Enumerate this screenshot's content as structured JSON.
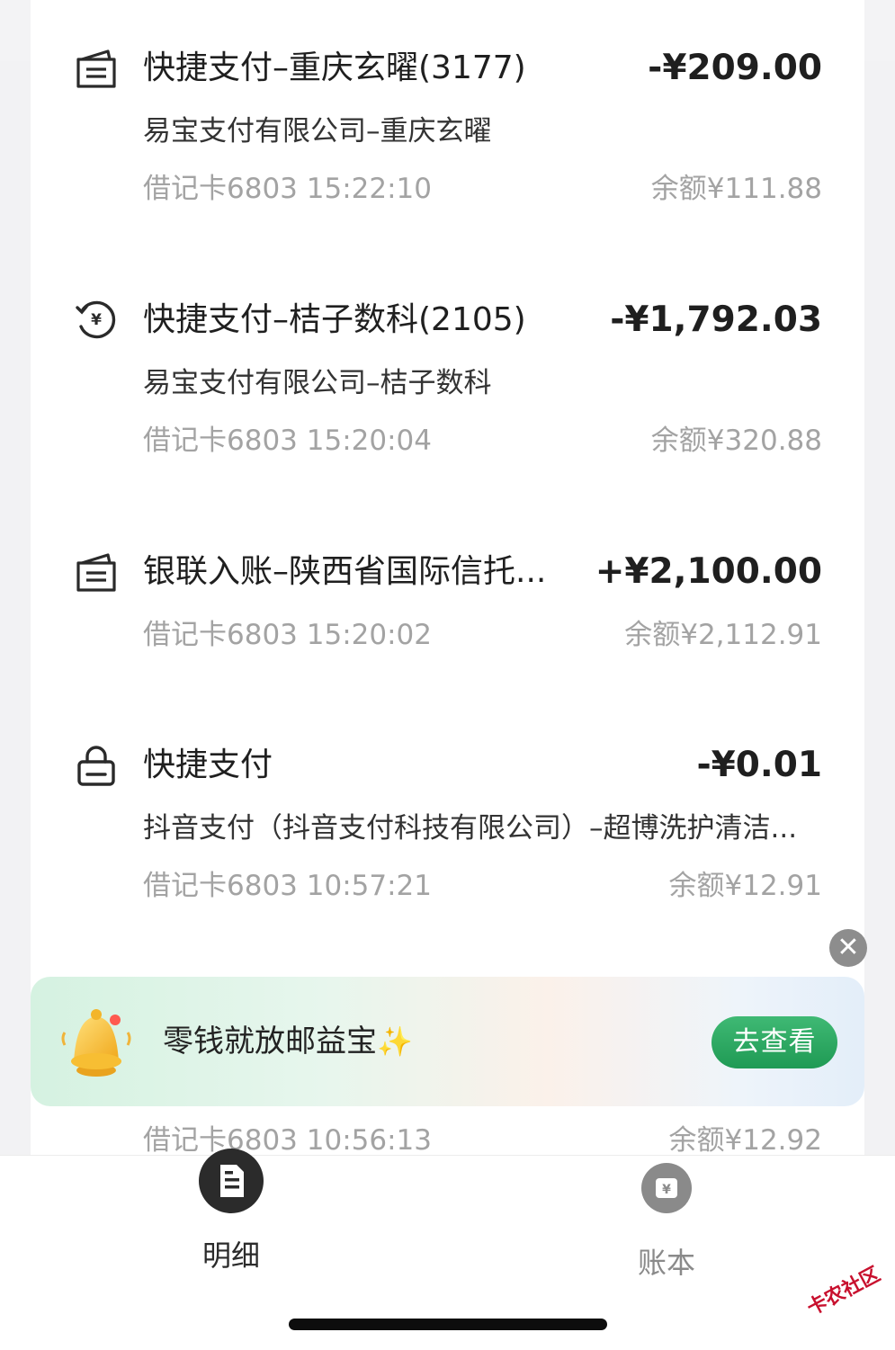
{
  "transactions": [
    {
      "icon": "receipt-icon",
      "title": "快捷支付–重庆玄曜(3177)",
      "amount": "-¥209.00",
      "merchant": "易宝支付有限公司–重庆玄曜",
      "meta": "借记卡6803 15:22:10",
      "balance": "余额¥111.88"
    },
    {
      "icon": "refund-yen-icon",
      "title": "快捷支付–桔子数科(2105)",
      "amount": "-¥1,792.03",
      "merchant": "易宝支付有限公司–桔子数科",
      "meta": "借记卡6803 15:20:04",
      "balance": "余额¥320.88"
    },
    {
      "icon": "receipt-icon",
      "title": "银联入账–陕西省国际信托...",
      "amount": "+¥2,100.00",
      "merchant": "",
      "meta": "借记卡6803 15:20:02",
      "balance": "余额¥2,112.91"
    },
    {
      "icon": "shopping-bag-icon",
      "title": "快捷支付",
      "amount": "-¥0.01",
      "merchant": "抖音支付（抖音支付科技有限公司）–超博洗护清洁...",
      "meta": "借记卡6803 10:57:21",
      "balance": "余额¥12.91"
    }
  ],
  "partial_row": {
    "meta": "借记卡6803 10:56:13",
    "balance": "余额¥12.92"
  },
  "banner": {
    "text": "零钱就放邮益宝",
    "button_label": "去查看",
    "icon": "bell-icon"
  },
  "tabbar": {
    "tabs": [
      {
        "label": "明细",
        "icon": "document-icon",
        "active": true
      },
      {
        "label": "账本",
        "icon": "ledger-icon",
        "active": false
      }
    ]
  },
  "watermark": "卡农社区",
  "colors": {
    "accent_green": "#2aa862",
    "text_primary": "#1f1f1f",
    "text_secondary": "#a3a3a3",
    "tab_active": "#2b2b2b",
    "tab_inactive": "#8a8a8a"
  }
}
